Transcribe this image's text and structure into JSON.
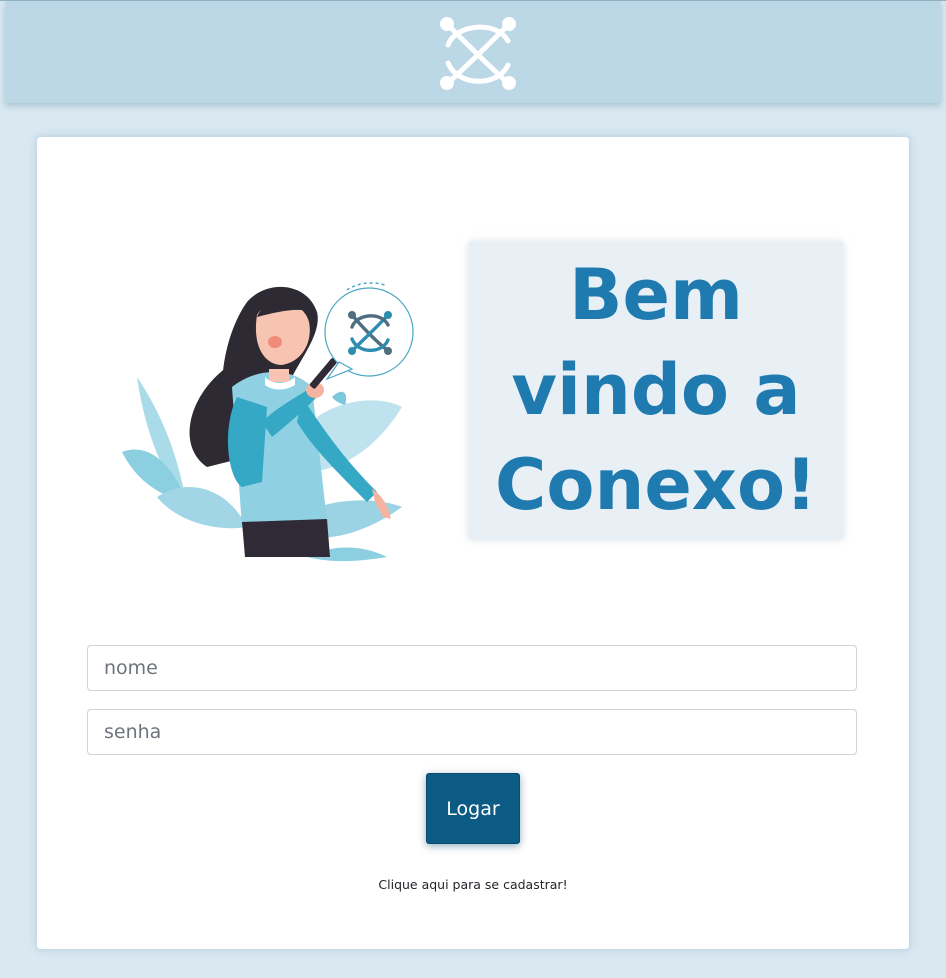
{
  "header": {
    "logo_icon": "conexo-logo-icon"
  },
  "welcome": {
    "heading": "Bem vindo a Conexo!"
  },
  "illustration": {
    "icon": "woman-with-phone-illustration",
    "bubble_icon": "conexo-logo-icon"
  },
  "form": {
    "name_placeholder": "nome",
    "name_value": "",
    "password_placeholder": "senha",
    "password_value": "",
    "login_label": "Logar",
    "signup_text": "Clique aqui para se cadastrar!"
  },
  "colors": {
    "page_bg": "#d9e8f1",
    "header_bg": "#bcd8e6",
    "accent": "#1f7aaf",
    "button_bg": "#0c5b84",
    "welcome_bg": "#e8eff5"
  }
}
